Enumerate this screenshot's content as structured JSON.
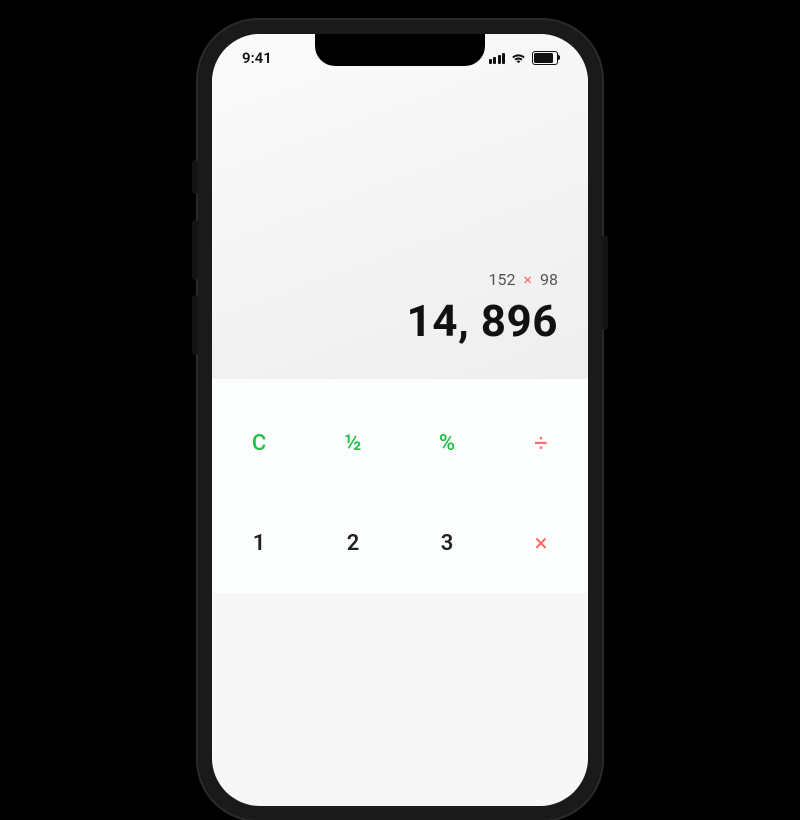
{
  "status": {
    "time": "9:41"
  },
  "display": {
    "expr_left": "152",
    "expr_op": "×",
    "expr_right": "98",
    "result": "14, 896"
  },
  "keys": {
    "clear": "C",
    "half": "½",
    "percent": "%",
    "divide": "÷",
    "one": "1",
    "two": "2",
    "three": "3",
    "multiply": "×"
  }
}
